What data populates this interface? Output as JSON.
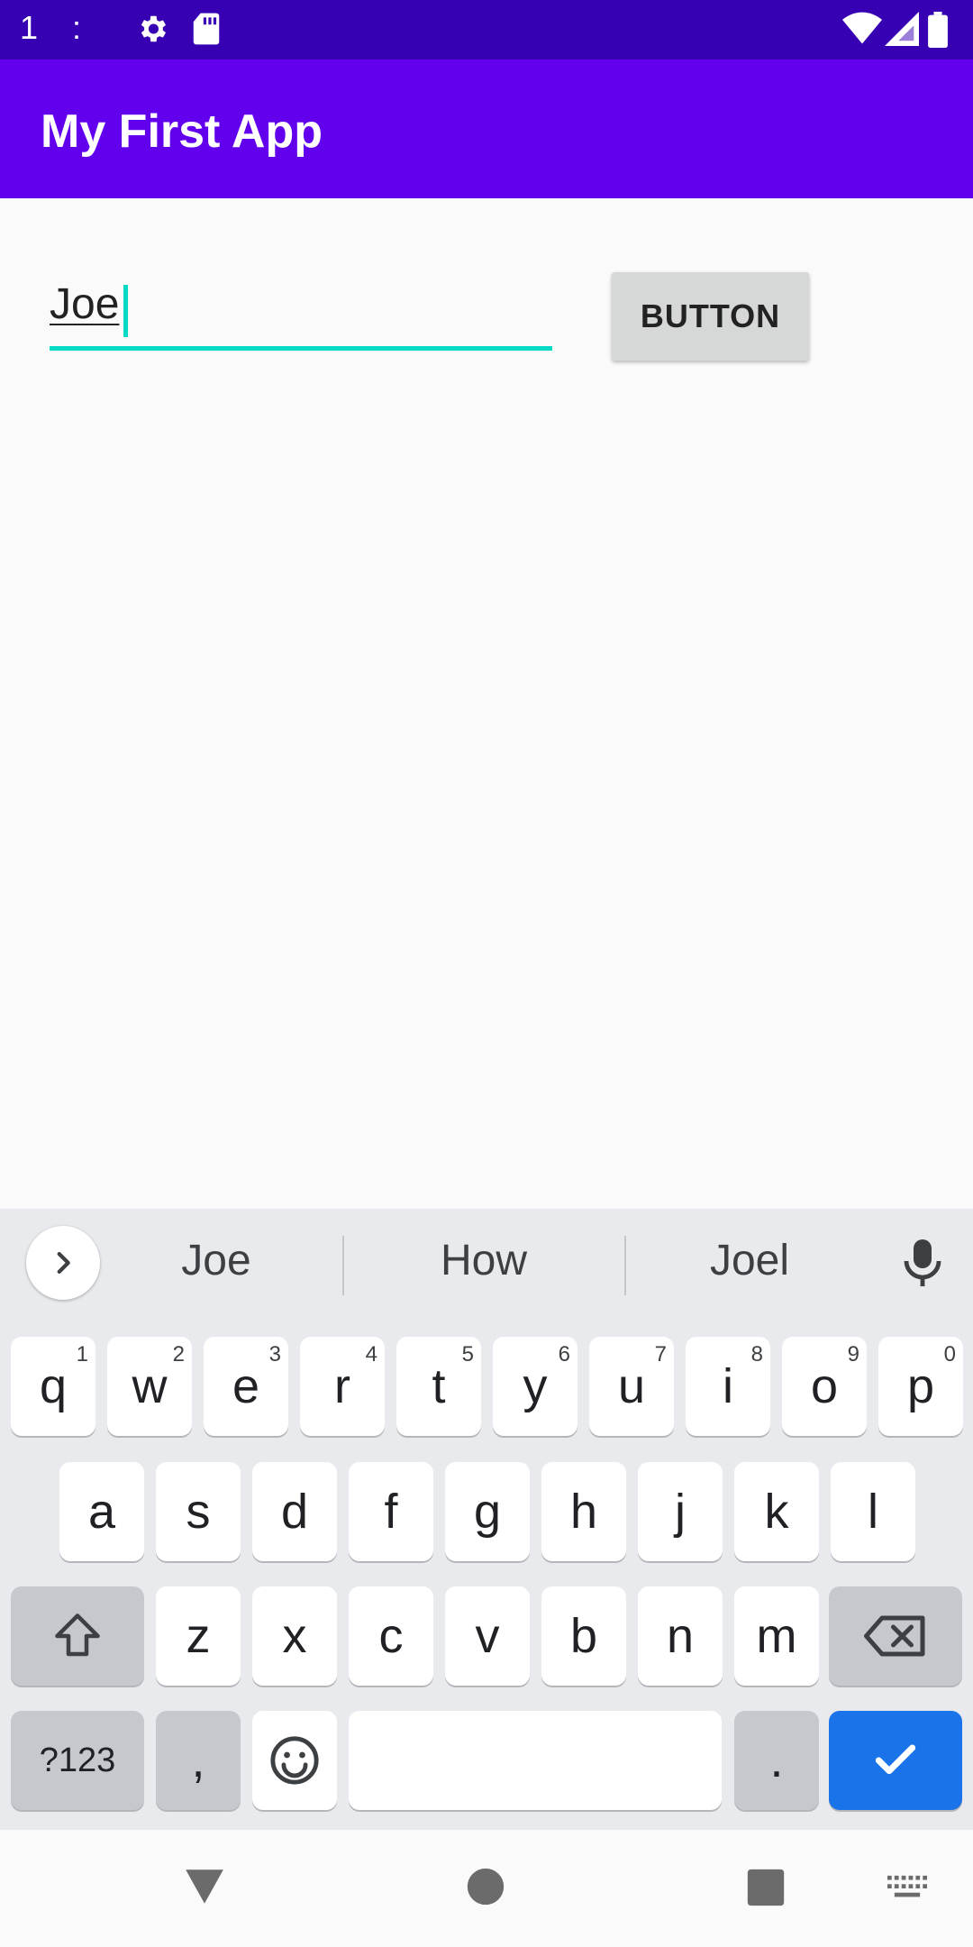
{
  "status_bar": {
    "time": "1 :",
    "icons": [
      "settings-icon",
      "sd-card-icon",
      "wifi-icon",
      "signal-icon",
      "battery-icon"
    ]
  },
  "app_bar": {
    "title": "My First App"
  },
  "form": {
    "name_value": "Joe",
    "button_label": "BUTTON"
  },
  "keyboard": {
    "suggestions": [
      "Joe",
      "How",
      "Joel"
    ],
    "row1": [
      {
        "label": "q",
        "hint": "1"
      },
      {
        "label": "w",
        "hint": "2"
      },
      {
        "label": "e",
        "hint": "3"
      },
      {
        "label": "r",
        "hint": "4"
      },
      {
        "label": "t",
        "hint": "5"
      },
      {
        "label": "y",
        "hint": "6"
      },
      {
        "label": "u",
        "hint": "7"
      },
      {
        "label": "i",
        "hint": "8"
      },
      {
        "label": "o",
        "hint": "9"
      },
      {
        "label": "p",
        "hint": "0"
      }
    ],
    "row2": [
      "a",
      "s",
      "d",
      "f",
      "g",
      "h",
      "j",
      "k",
      "l"
    ],
    "row3": [
      "z",
      "x",
      "c",
      "v",
      "b",
      "n",
      "m"
    ],
    "symbols_label": "?123",
    "comma_label": ",",
    "period_label": ".",
    "colors": {
      "accent": "#1A73E8",
      "background": "#E8EAED"
    }
  },
  "nav_bar": {
    "icons": [
      "back-icon",
      "home-icon",
      "recents-icon",
      "keyboard-switch-icon"
    ]
  },
  "theme": {
    "primary": "#6200EE",
    "primary_dark": "#3700B3",
    "accent": "#03DAC5"
  }
}
